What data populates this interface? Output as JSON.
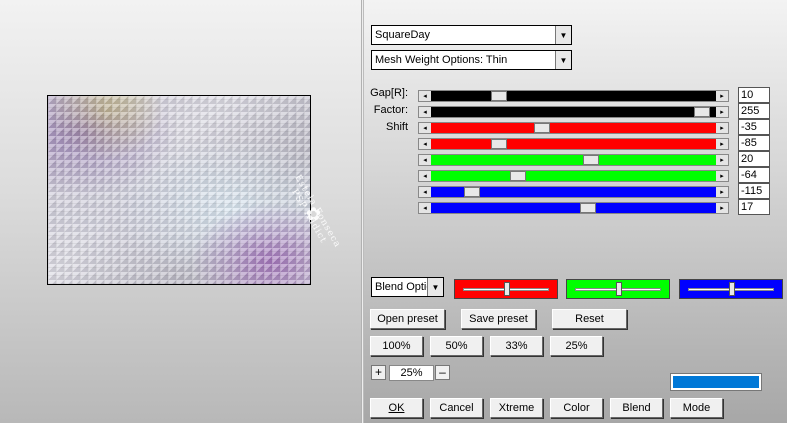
{
  "preset_name": "SquareDay",
  "mesh_weight": "Mesh Weight Options: Thin",
  "watermark_text": "Estela Fonseca PSP Addict",
  "labels": {
    "gap": "Gap[R]:",
    "factor": "Factor:",
    "shift": "Shift"
  },
  "sliders": [
    {
      "name": "gap",
      "value": "10",
      "track_color": "#000000",
      "thumb_fraction": 0.22
    },
    {
      "name": "factor",
      "value": "255",
      "track_color": "#000000",
      "thumb_fraction": 0.97
    },
    {
      "name": "shift-red-1",
      "value": "-35",
      "track_color": "#ff0000",
      "thumb_fraction": 0.38
    },
    {
      "name": "shift-red-2",
      "value": "-85",
      "track_color": "#ff0000",
      "thumb_fraction": 0.22
    },
    {
      "name": "shift-green-1",
      "value": "20",
      "track_color": "#00ff00",
      "thumb_fraction": 0.56
    },
    {
      "name": "shift-green-2",
      "value": "-64",
      "track_color": "#00ff00",
      "thumb_fraction": 0.29
    },
    {
      "name": "shift-blue-1",
      "value": "-115",
      "track_color": "#0000ff",
      "thumb_fraction": 0.12
    },
    {
      "name": "shift-blue-2",
      "value": "17",
      "track_color": "#0000ff",
      "thumb_fraction": 0.55
    }
  ],
  "blend_options": "Blend Optio",
  "blend_sliders": [
    {
      "color": "#ff0000",
      "fraction": 0.5
    },
    {
      "color": "#00ff00",
      "fraction": 0.5
    },
    {
      "color": "#0000ff",
      "fraction": 0.5
    }
  ],
  "buttons": {
    "open_preset": "Open preset",
    "save_preset": "Save preset",
    "reset": "Reset",
    "zoom100": "100%",
    "zoom50": "50%",
    "zoom33": "33%",
    "zoom25": "25%"
  },
  "zoom": {
    "plus": "+",
    "value": "25%",
    "minus": "–"
  },
  "swatch_color": "#0078d7",
  "bottom": {
    "ok": "OK",
    "cancel": "Cancel",
    "xtreme": "Xtreme",
    "color": "Color",
    "blend": "Blend",
    "mode": "Mode"
  },
  "icons": {
    "dropdown_arrow": "▼",
    "scroll_left": "◂",
    "scroll_right": "▸"
  }
}
